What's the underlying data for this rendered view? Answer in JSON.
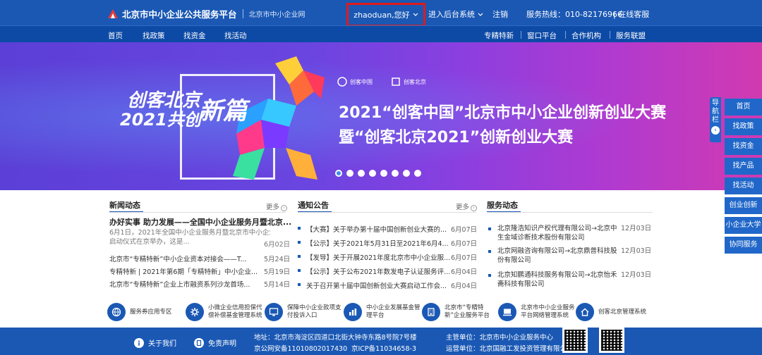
{
  "header": {
    "logo_title": "北京市中小企业公共服务平台",
    "logo_sub": "北京市中小企业网",
    "user_greeting": "zhaoduan,您好",
    "backend_label": "进入后台系统",
    "logout_label": "注销",
    "hotline": "服务热线：010-82176966",
    "online_service": "在线客服"
  },
  "nav": {
    "left": [
      "首页",
      "找政策",
      "找资金",
      "找活动"
    ],
    "right": [
      "专精特新",
      "窗口平台",
      "合作机构",
      "服务联盟"
    ]
  },
  "banner": {
    "slogan_line1": "创客北京",
    "slogan_line2": "2021共创",
    "slogan_big": "新篇",
    "logo1": "创客中国",
    "logo2": "创客北京",
    "title1": "2021“创客中国”北京市中小企业创新创业大赛",
    "title2": "暨“创客北京2021”创新创业大赛",
    "slides": 8,
    "active_slide": 1
  },
  "side_nav": {
    "tab_label": "导航栏",
    "tab_arrow": "‹",
    "items": [
      "首页",
      "找政策",
      "找资金",
      "找产品",
      "找活动",
      "创业创新",
      "小企业大学",
      "协同服务"
    ]
  },
  "news": {
    "title": "新闻动态",
    "more": "更多",
    "feature_title": "办好实事 助力发展——全国中小企业服务月暨北京...",
    "feature_ex1": "6月1日，2021年全国中小企业服务月暨北京市中小企业服务月",
    "feature_ex2": "启动仪式在京举办，这是...",
    "feature_date": "6月02日",
    "items": [
      {
        "text": "北京市“专精特新”中小企业资本对接会——T...",
        "date": "5月24日"
      },
      {
        "text": "专精特新 | 2021年第6期「专精特新」中小企业...",
        "date": "5月19日"
      },
      {
        "text": "北京市“专精特新”企业上市融资系列沙龙首场...",
        "date": "5月14日"
      }
    ]
  },
  "notice": {
    "title": "通知公告",
    "more": "更多",
    "items": [
      {
        "text": "【大赛】关于举办第十届中国创新创业大赛的...",
        "date": "6月07日"
      },
      {
        "text": "【公示】关于2021年5月31日至2021年6月4...",
        "date": "6月07日"
      },
      {
        "text": "【发导】关于开展2021年度北京市中小企业服...",
        "date": "6月07日"
      },
      {
        "text": "【公示】关于公布2021年数发电子认证服务评...",
        "date": "6月04日"
      },
      {
        "text": "关于召开第十届中国创新创业大赛启动工作会...",
        "date": "6月04日"
      }
    ]
  },
  "service": {
    "title": "服务动态",
    "items": [
      {
        "text": "北京隆浩知识产权代理有限公司→北京中生金域诊断技术股份有限公司",
        "date": "12月03日"
      },
      {
        "text": "北京网融咨询有限公司→北京鼎普科技股份有限公司",
        "date": "12月03日"
      },
      {
        "text": "北京知鹏通科技服务有限公司→北京怡禾斋科技有限公司",
        "date": "12月03日"
      }
    ]
  },
  "quick_services": [
    {
      "icon": "globe-icon",
      "lines": [
        "服务券应用专区"
      ]
    },
    {
      "icon": "gear-icon",
      "lines": [
        "小微企业信用担保代",
        "偿补偿基金管理系统"
      ]
    },
    {
      "icon": "monitor-icon",
      "lines": [
        "保障中小企业款项支",
        "付投诉入口"
      ]
    },
    {
      "icon": "chart-icon",
      "lines": [
        "中小企业发展基金管",
        "理平台"
      ]
    },
    {
      "icon": "building-icon",
      "lines": [
        "北京市“专精特",
        "新”企业服务平台"
      ]
    },
    {
      "icon": "computer-icon",
      "lines": [
        "北京市中小企业服务",
        "平台网络管理系统"
      ]
    },
    {
      "icon": "house-icon",
      "lines": [
        "创客北京管理系统"
      ]
    }
  ],
  "footer": {
    "about": "关于我们",
    "disclaimer": "免责声明",
    "address": "地址：北京市海淀区四道口北街大钟寺东路8号院7号楼",
    "icp1": "京公网安备11010802017430",
    "icp2": "京ICP备11034658-3",
    "host": "主管单位：北京市中小企业服务中心",
    "operator": "运营单位：北京国融工发投资管理有限公司"
  },
  "colors": {
    "primary": "#1a58b4",
    "nav": "#0d4aa6",
    "highlight_box": "#e01a1a"
  }
}
